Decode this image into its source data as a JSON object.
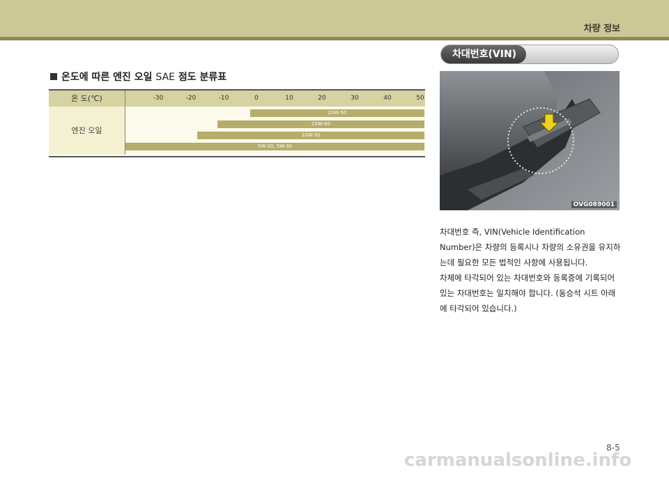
{
  "header": {
    "title": "차량 정보"
  },
  "oil_section": {
    "title_prefix": "온도에 따른 엔진 오일",
    "title_sae": "SAE",
    "title_suffix": "점도 분류표"
  },
  "oil_table": {
    "header_label": "온  도(℃)",
    "row_label": "엔진 오일",
    "ticks": [
      "-30",
      "-20",
      "-10",
      "0",
      "10",
      "20",
      "30",
      "40",
      "50"
    ],
    "bars": [
      {
        "label": "20W-50",
        "from": -2,
        "to": 50
      },
      {
        "label": "15W-40",
        "from": -12,
        "to": 50
      },
      {
        "label": "10W-30",
        "from": -18,
        "to": 50
      },
      {
        "label": "5W-20,  5W-30",
        "from": -45,
        "to": 50
      }
    ]
  },
  "vin_section": {
    "title": "차대번호(VIN)",
    "image_code": "OVG089001",
    "paragraph1": "차대번호 즉, VIN(Vehicle Identification Number)은 차량의 등록시나 차량의 소유권을 유지하는데 필요한 모든 법적인 사항에 사용됩니다.",
    "paragraph2": "차체에 타각되어 있는 차대번호와 등록증에 기록되어 있는 차대번호는 일치해야 합니다. (동승석 시트 아래에 타각되어 있습니다.)"
  },
  "footer": {
    "page_number": "8-5"
  },
  "watermark": "carmanualsonline.info",
  "colors": {
    "band": "#ccc896",
    "band_line": "#8c8a56",
    "bar": "#b4ad6c",
    "row_bg": "#f4f0d2"
  }
}
